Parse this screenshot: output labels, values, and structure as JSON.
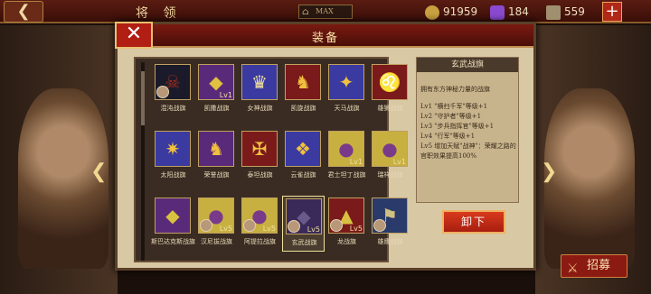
{
  "topbar": {
    "back_icon": "back-arrow-icon",
    "title": "将 领",
    "rank_label": "MAX",
    "resources": [
      {
        "name": "coin",
        "value": "91959",
        "color": "#c8a040"
      },
      {
        "name": "gem",
        "value": "184",
        "color": "#8a4ad0"
      },
      {
        "name": "scroll",
        "value": "559",
        "color": "#a09070"
      }
    ],
    "plus_label": "+"
  },
  "background": {
    "recruit_label": "招募"
  },
  "modal": {
    "title": "装备",
    "close_label": "✕",
    "flags": [
      {
        "name": "混沌战旗",
        "color": "#1a1a2a",
        "emblem": "☠",
        "emblem_color": "#a03020",
        "level": "",
        "equipped": true
      },
      {
        "name": "凯撒战旗",
        "color": "#5a2a7a",
        "emblem": "◆",
        "emblem_color": "#e0c040",
        "level": "Lv1",
        "equipped": false
      },
      {
        "name": "女神战旗",
        "color": "#3a3aa0",
        "emblem": "♛",
        "emblem_color": "#f0e0a0",
        "level": "",
        "equipped": false
      },
      {
        "name": "凯旋战旗",
        "color": "#7a1a1a",
        "emblem": "♞",
        "emblem_color": "#f0c040",
        "level": "",
        "equipped": false
      },
      {
        "name": "天马战旗",
        "color": "#3a3aa0",
        "emblem": "✦",
        "emblem_color": "#f0c040",
        "level": "",
        "equipped": false
      },
      {
        "name": "雄狮战旗",
        "color": "#7a1a1a",
        "emblem": "♌",
        "emblem_color": "#f0c040",
        "level": "",
        "equipped": false
      },
      {
        "name": "太阳战旗",
        "color": "#3a3aa0",
        "emblem": "✷",
        "emblem_color": "#f0c040",
        "level": "",
        "equipped": false
      },
      {
        "name": "荣誉战旗",
        "color": "#5a2a7a",
        "emblem": "♞",
        "emblem_color": "#f0c040",
        "level": "",
        "equipped": false
      },
      {
        "name": "泰坦战旗",
        "color": "#7a1a1a",
        "emblem": "✠",
        "emblem_color": "#f0c040",
        "level": "",
        "equipped": false
      },
      {
        "name": "云雀战旗",
        "color": "#3a3aa0",
        "emblem": "❖",
        "emblem_color": "#f0c040",
        "level": "",
        "equipped": false
      },
      {
        "name": "君士坦丁战旗",
        "color": "#c8b040",
        "emblem": "●",
        "emblem_color": "#7a3a8a",
        "level": "Lv1",
        "equipped": false
      },
      {
        "name": "瑞祥战旗",
        "color": "#c8b040",
        "emblem": "●",
        "emblem_color": "#7a3a8a",
        "level": "Lv1",
        "equipped": false
      },
      {
        "name": "斯巴达克斯战旗",
        "color": "#5a2a7a",
        "emblem": "◆",
        "emblem_color": "#d8c040",
        "level": "",
        "equipped": false
      },
      {
        "name": "汉尼拔战旗",
        "color": "#c8b040",
        "emblem": "●",
        "emblem_color": "#7a3a8a",
        "level": "Lv5",
        "equipped": true
      },
      {
        "name": "阿提拉战旗",
        "color": "#c8b040",
        "emblem": "●",
        "emblem_color": "#7a3a8a",
        "level": "Lv5",
        "equipped": true
      },
      {
        "name": "玄武战旗",
        "color": "#3a2a5a",
        "emblem": "◆",
        "emblem_color": "#6a5a8a",
        "level": "Lv5",
        "equipped": true
      },
      {
        "name": "龙战旗",
        "color": "#7a1a1a",
        "emblem": "▲",
        "emblem_color": "#d8c040",
        "level": "Lv5",
        "equipped": true
      },
      {
        "name": "雄鹰战旗",
        "color": "#2a3a6a",
        "emblem": "⚑",
        "emblem_color": "#d0c080",
        "level": "",
        "equipped": true
      }
    ],
    "selected_index": 15,
    "info": {
      "title": "玄武战旗",
      "description": "拥有东方神秘力量的战旗",
      "levels": [
        "Lv1 \"横扫千军\"等级+1",
        "Lv2 \"守护者\"等级+1",
        "Lv3 \"步兵指挥官\"等级+1",
        "Lv4 \"行军\"等级+1",
        "Lv5 增加天赋\"战神\"：荣耀之路的官职效果提高100%"
      ]
    },
    "unequip_label": "卸下"
  }
}
